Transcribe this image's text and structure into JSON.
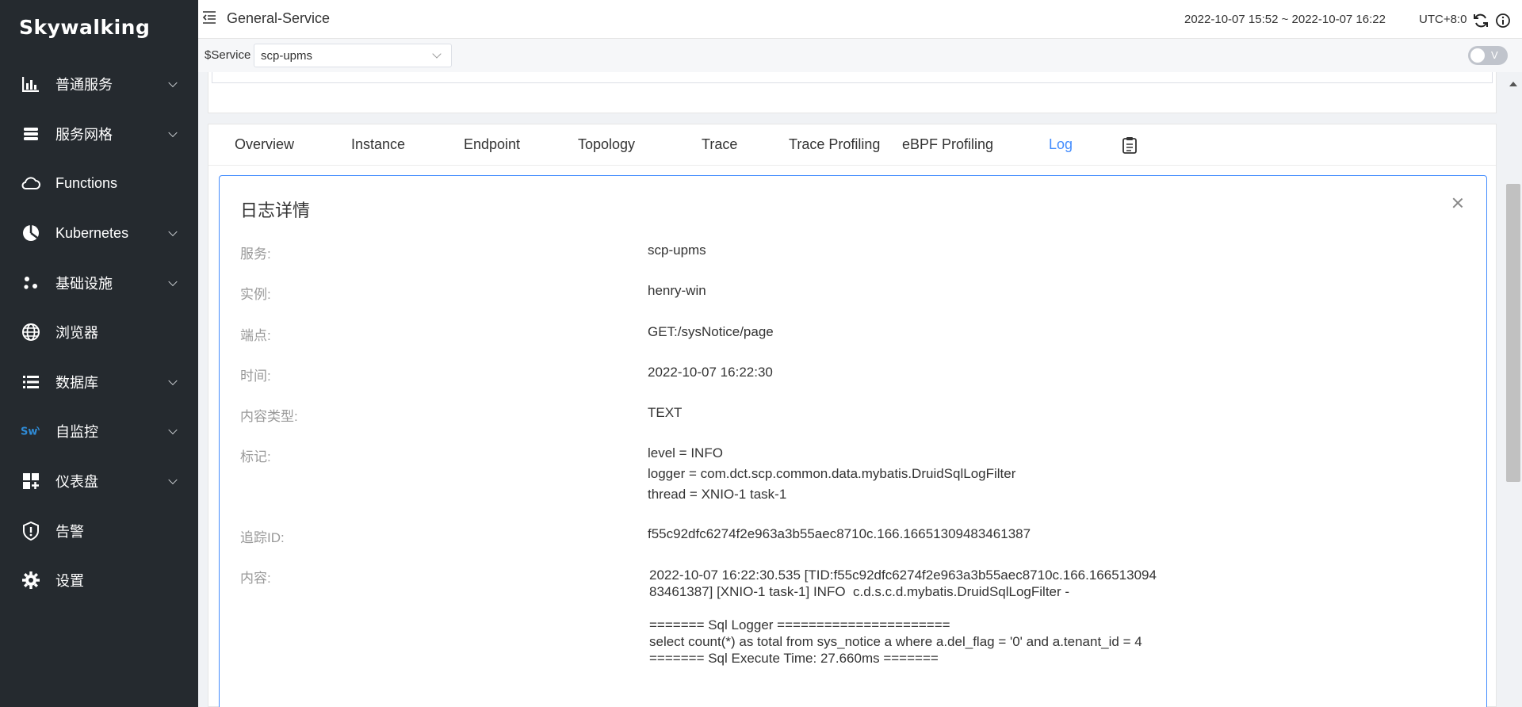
{
  "sidebar": {
    "logo": "Skywalking",
    "items": [
      {
        "label": "普通服务",
        "icon": "bar-chart-icon",
        "has_children": true
      },
      {
        "label": "服务网格",
        "icon": "layers-icon",
        "has_children": true
      },
      {
        "label": "Functions",
        "icon": "cloud-icon",
        "has_children": false
      },
      {
        "label": "Kubernetes",
        "icon": "pie-chart-icon",
        "has_children": true
      },
      {
        "label": "基础设施",
        "icon": "nodes-icon",
        "has_children": true
      },
      {
        "label": "浏览器",
        "icon": "globe-icon",
        "has_children": false
      },
      {
        "label": "数据库",
        "icon": "list-icon",
        "has_children": true
      },
      {
        "label": "自监控",
        "icon": "sw-icon",
        "has_children": true
      },
      {
        "label": "仪表盘",
        "icon": "dashboard-icon",
        "has_children": true
      },
      {
        "label": "告警",
        "icon": "alert-shield-icon",
        "has_children": false
      },
      {
        "label": "设置",
        "icon": "gear-icon",
        "has_children": false
      }
    ]
  },
  "header": {
    "title": "General-Service",
    "time_range": "2022-10-07 15:52 ~ 2022-10-07 16:22",
    "timezone": "UTC+8:0"
  },
  "toolbar": {
    "service_label": "$Service",
    "service_value": "scp-upms",
    "toggle_label": "V"
  },
  "tabs": [
    {
      "label": "Overview",
      "active": false
    },
    {
      "label": "Instance",
      "active": false
    },
    {
      "label": "Endpoint",
      "active": false
    },
    {
      "label": "Topology",
      "active": false
    },
    {
      "label": "Trace",
      "active": false
    },
    {
      "label": "Trace Profiling",
      "active": false
    },
    {
      "label": "eBPF Profiling",
      "active": false
    },
    {
      "label": "Log",
      "active": true
    }
  ],
  "detail": {
    "title": "日志详情",
    "service_label": "服务:",
    "service": "scp-upms",
    "instance_label": "实例:",
    "instance": "henry-win",
    "endpoint_label": "端点:",
    "endpoint": "GET:/sysNotice/page",
    "time_label": "时间:",
    "time": "2022-10-07 16:22:30",
    "content_type_label": "内容类型:",
    "content_type": "TEXT",
    "tags_label": "标记:",
    "tags": [
      "level = INFO",
      "logger = com.dct.scp.common.data.mybatis.DruidSqlLogFilter",
      "thread = XNIO-1 task-1"
    ],
    "trace_id_label": "追踪ID:",
    "trace_id": "f55c92dfc6274f2e963a3b55aec8710c.166.16651309483461387",
    "content_label": "内容:",
    "content": "2022-10-07 16:22:30.535 [TID:f55c92dfc6274f2e963a3b55aec8710c.166.16651309483461387] [XNIO-1 task-1] INFO  c.d.s.c.d.mybatis.DruidSqlLogFilter -\n\n======= Sql Logger ======================\nselect count(*) as total from sys_notice a where a.del_flag = '0' and a.tenant_id = 4\n======= Sql Execute Time: 27.660ms ======="
  },
  "colors": {
    "sidebar_bg": "#252a2f",
    "accent": "#448dfe"
  }
}
